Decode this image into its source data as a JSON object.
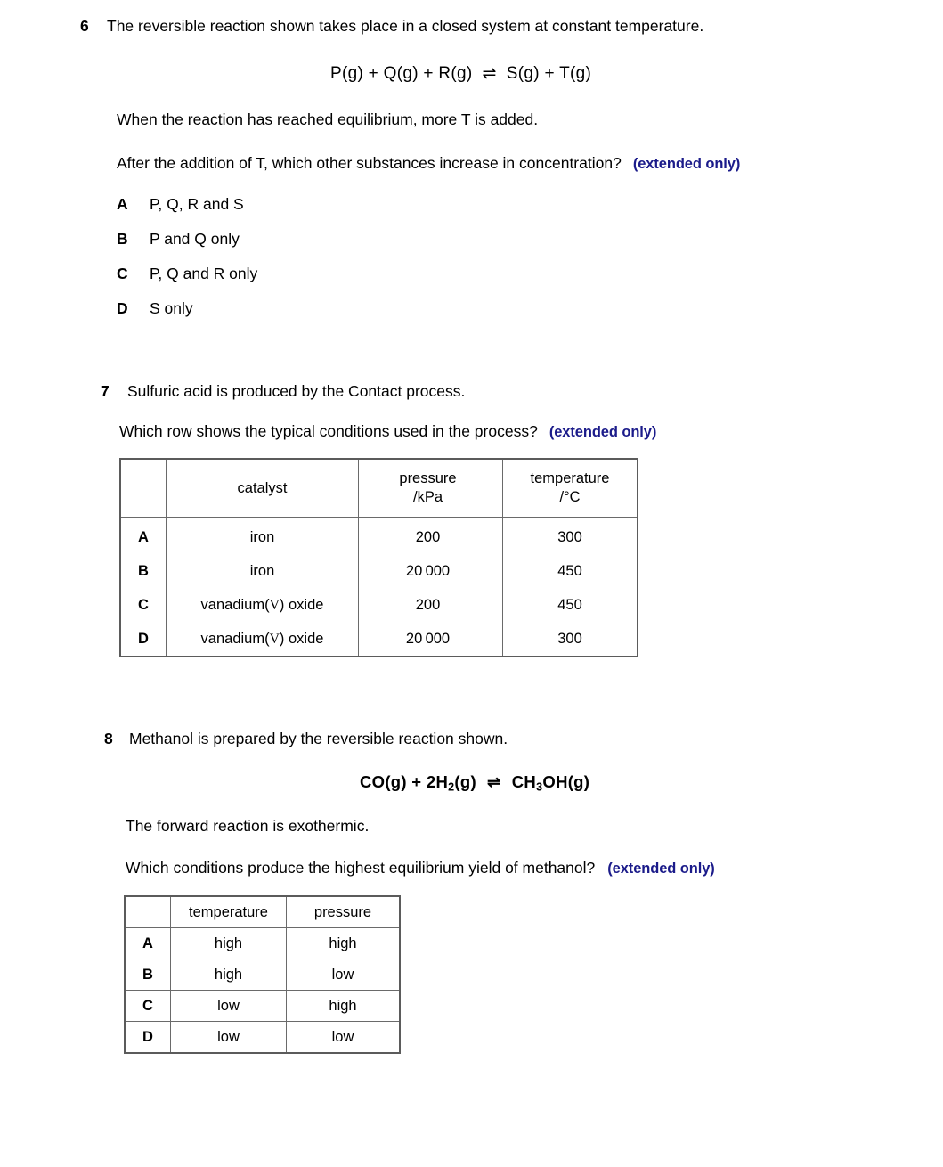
{
  "theme": {
    "text_color": "#000000",
    "extended_color": "#1b1b8a",
    "table_border": "#5b5b5b"
  },
  "extended_label": "(extended only)",
  "questions": [
    {
      "number": "6",
      "stem": "The reversible reaction shown takes place in a closed system at constant temperature.",
      "equation": {
        "left": "P(g)  +  Q(g)  +  R(g)",
        "arrow": "⇌",
        "right": "S(g)  +  T(g)"
      },
      "line2": "When the reaction has reached equilibrium, more T is added.",
      "line3": "After the addition of T, which other substances increase in concentration?",
      "options": [
        {
          "letter": "A",
          "text": "P, Q, R and S"
        },
        {
          "letter": "B",
          "text": "P and Q only"
        },
        {
          "letter": "C",
          "text": "P, Q and R only"
        },
        {
          "letter": "D",
          "text": "S only"
        }
      ]
    },
    {
      "number": "7",
      "stem": "Sulfuric acid is produced by the Contact process.",
      "line2": "Which row shows the typical conditions used in the process?",
      "table": {
        "headers": {
          "key": "",
          "catalyst": "catalyst",
          "pressure_line1": "pressure",
          "pressure_line2": "/kPa",
          "temperature_line1": "temperature",
          "temperature_line2": "/°C"
        },
        "rows": [
          {
            "key": "A",
            "catalyst_pre": "iron",
            "catalyst_rn": "",
            "catalyst_post": "",
            "pressure": "200",
            "temperature": "300"
          },
          {
            "key": "B",
            "catalyst_pre": "iron",
            "catalyst_rn": "",
            "catalyst_post": "",
            "pressure": "20 000",
            "temperature": "450"
          },
          {
            "key": "C",
            "catalyst_pre": "vanadium(",
            "catalyst_rn": "V",
            "catalyst_post": ") oxide",
            "pressure": "200",
            "temperature": "450"
          },
          {
            "key": "D",
            "catalyst_pre": "vanadium(",
            "catalyst_rn": "V",
            "catalyst_post": ") oxide",
            "pressure": "20 000",
            "temperature": "300"
          }
        ]
      }
    },
    {
      "number": "8",
      "stem": "Methanol is prepared by the reversible reaction shown.",
      "equation": {
        "left_a": "CO(g)  +  2H",
        "left_sub": "2",
        "left_b": "(g)",
        "arrow": "⇌",
        "right_a": "CH",
        "right_sub": "3",
        "right_b": "OH(g)"
      },
      "line2": "The forward reaction is exothermic.",
      "line3": "Which conditions produce the highest equilibrium yield of methanol?",
      "table": {
        "headers": {
          "key": "",
          "temperature": "temperature",
          "pressure": "pressure"
        },
        "rows": [
          {
            "key": "A",
            "temperature": "high",
            "pressure": "high"
          },
          {
            "key": "B",
            "temperature": "high",
            "pressure": "low"
          },
          {
            "key": "C",
            "temperature": "low",
            "pressure": "high"
          },
          {
            "key": "D",
            "temperature": "low",
            "pressure": "low"
          }
        ]
      }
    }
  ]
}
